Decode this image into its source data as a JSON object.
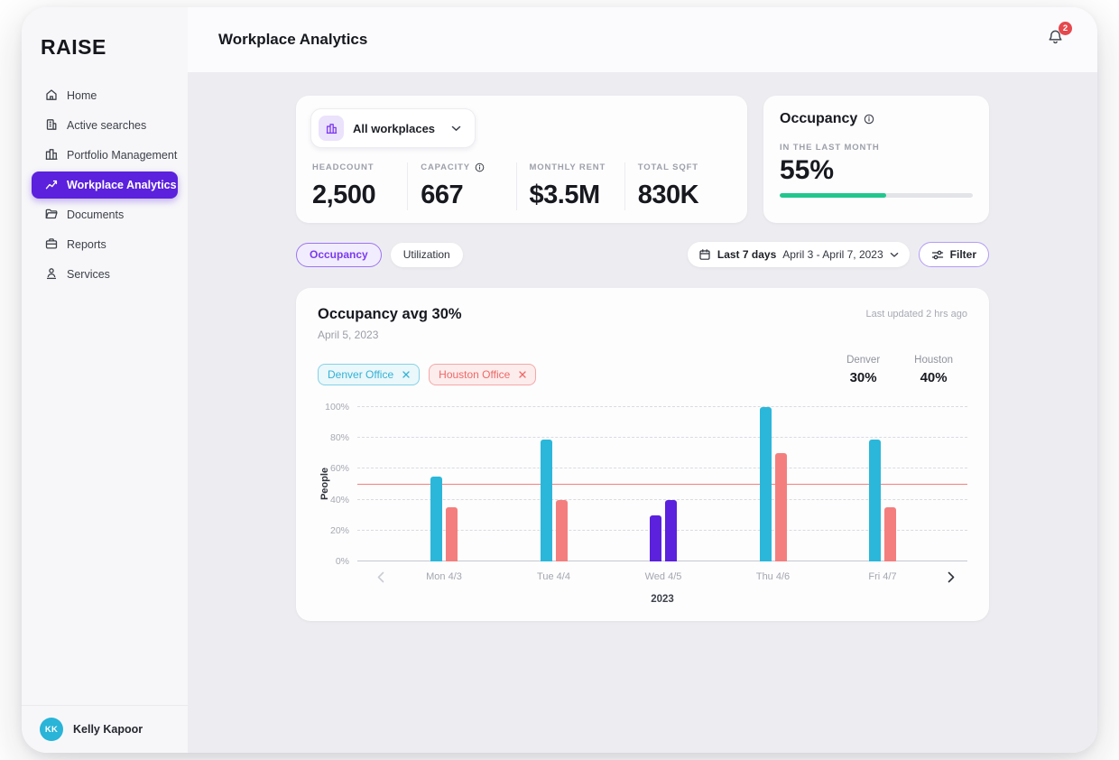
{
  "app": {
    "logo": "RAISE"
  },
  "sidebar": {
    "items": [
      {
        "label": "Home",
        "active": false
      },
      {
        "label": "Active searches",
        "active": false
      },
      {
        "label": "Portfolio Management",
        "active": false
      },
      {
        "label": "Workplace Analytics",
        "active": true
      },
      {
        "label": "Documents",
        "active": false
      },
      {
        "label": "Reports",
        "active": false
      },
      {
        "label": "Services",
        "active": false
      }
    ],
    "user": {
      "initials": "KK",
      "name": "Kelly Kapoor"
    }
  },
  "header": {
    "title": "Workplace Analytics",
    "notification_count": "2"
  },
  "stats_card": {
    "workplace_selector": {
      "label": "All workplaces"
    },
    "stats": [
      {
        "label": "HEADCOUNT",
        "value": "2,500"
      },
      {
        "label": "CAPACITY",
        "value": "667",
        "has_info": true
      },
      {
        "label": "MONTHLY RENT",
        "value": "$3.5M"
      },
      {
        "label": "TOTAL SQFT",
        "value": "830K"
      }
    ]
  },
  "occupancy_card": {
    "title": "Occupancy",
    "period_label": "IN THE LAST MONTH",
    "value": "55%",
    "progress_pct": 55,
    "bar_color": "#21C68E"
  },
  "controls": {
    "tabs": [
      {
        "label": "Occupancy",
        "active": true
      },
      {
        "label": "Utilization",
        "active": false
      }
    ],
    "date_range": {
      "preset": "Last 7 days",
      "range": "April 3 - April 7, 2023"
    },
    "filter_label": "Filter"
  },
  "chart_card": {
    "title": "Occupancy avg 30%",
    "subtitle": "April 5, 2023",
    "last_updated": "Last updated 2 hrs ago",
    "chips": [
      {
        "label": "Denver Office",
        "accent": "#33B2D4"
      },
      {
        "label": "Houston Office",
        "accent": "#EE6868"
      }
    ],
    "legend_stats": [
      {
        "label": "Denver",
        "value": "30%"
      },
      {
        "label": "Houston",
        "value": "40%"
      }
    ],
    "year_label": "2023"
  },
  "chart_data": {
    "type": "bar",
    "title": "Occupancy avg 30%",
    "ylabel": "People",
    "categories": [
      "Mon 4/3",
      "Tue 4/4",
      "Wed 4/5",
      "Thu 4/6",
      "Fri 4/7"
    ],
    "series": [
      {
        "name": "Denver Office",
        "color": "#2BB7DA",
        "values": [
          55,
          79,
          30,
          100,
          79
        ]
      },
      {
        "name": "Houston Office",
        "color": "#F47E7E",
        "values": [
          35,
          40,
          40,
          70,
          35
        ]
      }
    ],
    "highlight_index": 2,
    "highlight_color": "#5B21DD",
    "reference_line": 50,
    "reference_color": "#F47E7E",
    "y_ticks": [
      "0%",
      "20%",
      "40%",
      "60%",
      "80%",
      "100%"
    ],
    "ylim": [
      0,
      100
    ],
    "grid": "horizontal-dashed",
    "legend_position": "top-right"
  }
}
